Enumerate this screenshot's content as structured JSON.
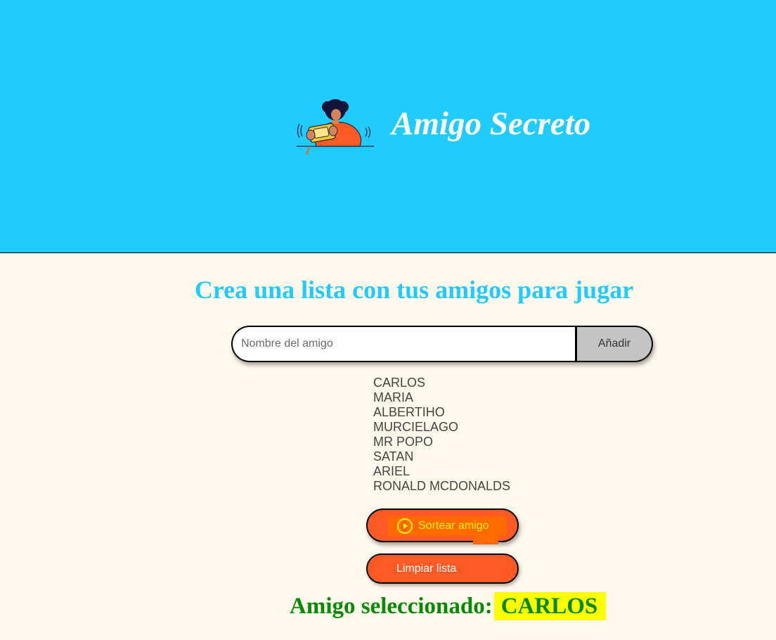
{
  "header": {
    "title": "Amigo Secreto",
    "illustration": "person-playing-handheld-game",
    "background_color": "#1FCBFF"
  },
  "main": {
    "heading": "Crea una lista con tus amigos para jugar",
    "heading_color": "#1FCBFF",
    "background_color": "#FFF9EB",
    "input": {
      "placeholder": "Nombre del amigo",
      "value": ""
    },
    "add_button_label": "Añadir",
    "friends": [
      "CARLOS",
      "MARIA",
      "ALBERTIHO",
      "MURCIELAGO",
      "MR POPO",
      "SATAN",
      "ARIEL",
      "RONALD MCDONALDS"
    ],
    "draw_button": {
      "label": "Sortear amigo",
      "icon": "play-circle-icon",
      "color": "#FF5A24",
      "highlight_color": "#FF6A00"
    },
    "clear_button": {
      "label": "Limpiar lista",
      "color": "#FF5A24"
    },
    "result": {
      "prefix": "Amigo seleccionado:",
      "name": "CARLOS",
      "color": "#058A05",
      "highlight_color": "#FFFF00"
    }
  }
}
